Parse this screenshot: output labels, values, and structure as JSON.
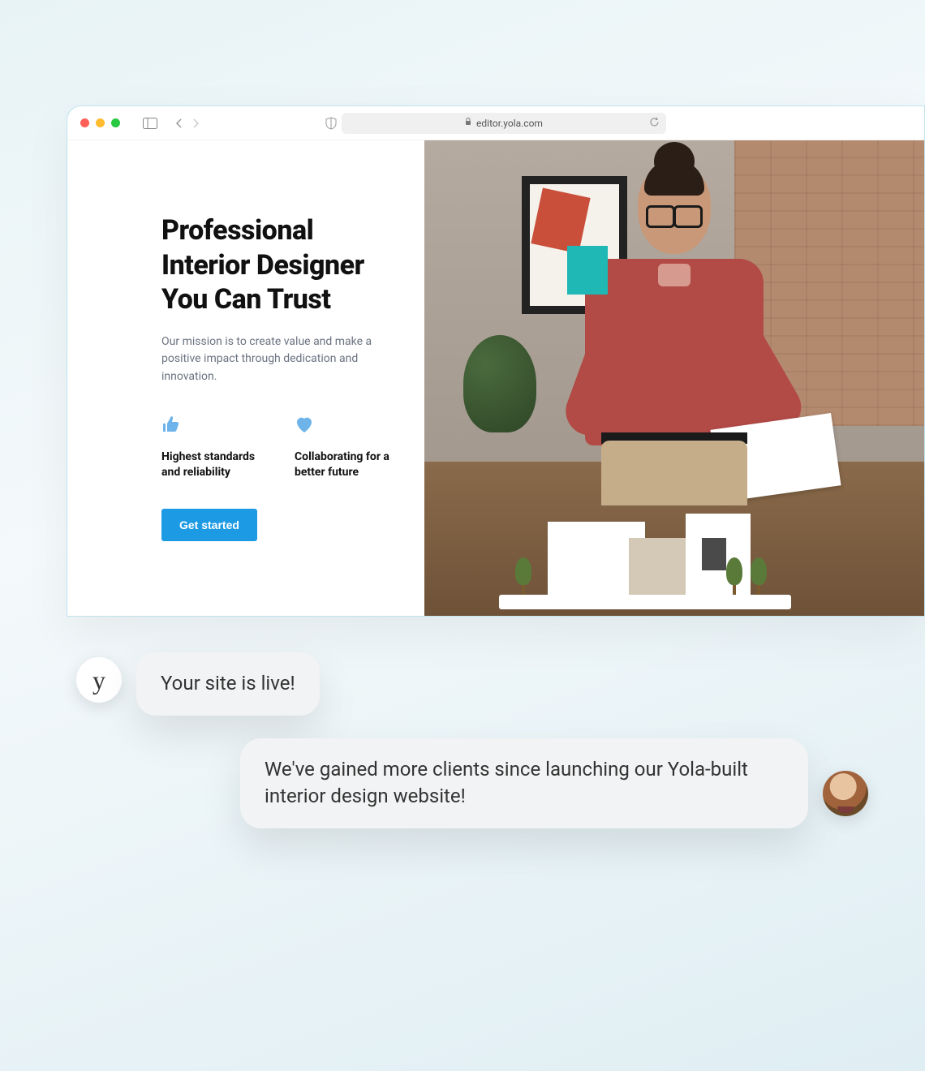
{
  "browser": {
    "url": "editor.yola.com"
  },
  "hero": {
    "headline": "Professional Interior Designer You Can Trust",
    "sub": "Our mission is to create value and make a positive impact through dedication and innovation.",
    "feature1": "Highest standards and reliability",
    "feature2": "Collaborating for a better future",
    "cta": "Get started"
  },
  "chat": {
    "brand_letter": "y",
    "msg1": "Your site is live!",
    "msg2": "We've gained more clients since launching our Yola-built interior design website!"
  }
}
